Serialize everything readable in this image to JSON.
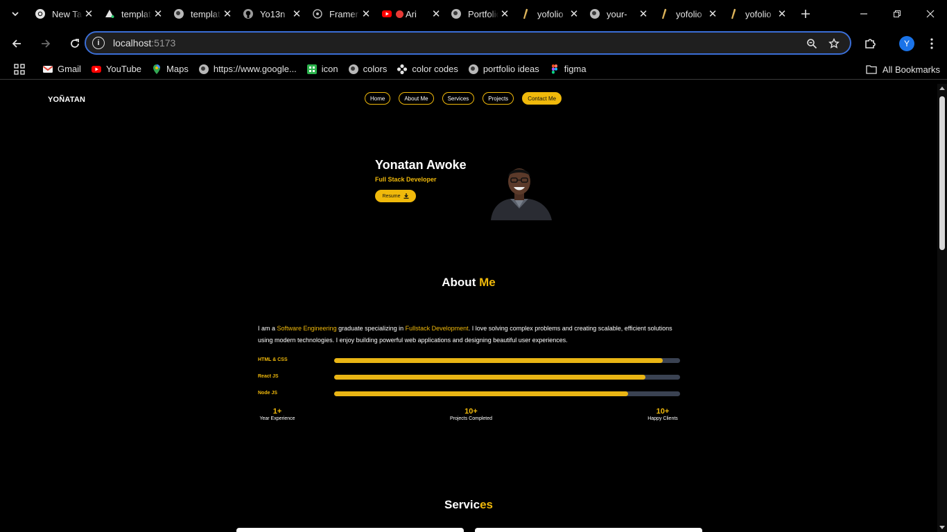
{
  "browser": {
    "tabs": [
      {
        "title": "New Tab",
        "icon": "chrome-icon"
      },
      {
        "title": "template",
        "icon": "triangle-icon"
      },
      {
        "title": "template",
        "icon": "globe-icon"
      },
      {
        "title": "Yo13n",
        "icon": "github-icon"
      },
      {
        "title": "Framer",
        "icon": "framer-icon"
      },
      {
        "title": "Ari",
        "icon": "youtube-icon"
      },
      {
        "title": "Portfolio",
        "icon": "globe-icon"
      },
      {
        "title": "yofolio",
        "icon": "pen-icon"
      },
      {
        "title": "your-",
        "icon": "globe-icon"
      },
      {
        "title": "yofolio",
        "icon": "pen-icon"
      },
      {
        "title": "yofolio",
        "icon": "pen-icon"
      }
    ],
    "address": {
      "host": "localhost",
      "port": ":5173"
    },
    "profile_initial": "Y",
    "bookmarks": [
      {
        "label": "Gmail",
        "icon": "gmail-icon"
      },
      {
        "label": "YouTube",
        "icon": "youtube-icon"
      },
      {
        "label": "Maps",
        "icon": "maps-icon"
      },
      {
        "label": "https://www.google...",
        "icon": "globe-icon"
      },
      {
        "label": "icon",
        "icon": "icon-app-icon"
      },
      {
        "label": "colors",
        "icon": "globe-icon"
      },
      {
        "label": "color codes",
        "icon": "flower-icon"
      },
      {
        "label": "portfolio ideas",
        "icon": "globe-icon"
      },
      {
        "label": "figma",
        "icon": "figma-icon"
      }
    ],
    "all_bookmarks": "All Bookmarks"
  },
  "site": {
    "logo": "YOÑATAN",
    "nav": [
      "Home",
      "About Me",
      "Services",
      "Projects",
      "Contact Me"
    ],
    "active_nav": "Contact Me",
    "accent": "#f0b90b",
    "hero": {
      "name": "Yonatan Awoke",
      "role": "Full Stack Developer",
      "resume": "Resume"
    },
    "about": {
      "title_plain": "About ",
      "title_accent": "Me",
      "text": {
        "p1": "I am a ",
        "h1": "Software Engineering",
        "p2": " graduate specializing in ",
        "h2": "Fullstack Development",
        "p3": ". I love solving complex problems and creating scalable, efficient solutions using modern technologies. I enjoy building powerful web applications and designing beautiful user experiences."
      },
      "skills": [
        {
          "name": "HTML & CSS",
          "level": 95
        },
        {
          "name": "React JS",
          "level": 90
        },
        {
          "name": "Node JS",
          "level": 85
        }
      ],
      "stats": [
        {
          "value": "1+",
          "label": "Year Experience"
        },
        {
          "value": "10+",
          "label": "Projects Completed"
        },
        {
          "value": "10+",
          "label": "Happy Clients"
        }
      ]
    },
    "services": {
      "title_plain": "Servic",
      "title_accent": "es"
    }
  }
}
